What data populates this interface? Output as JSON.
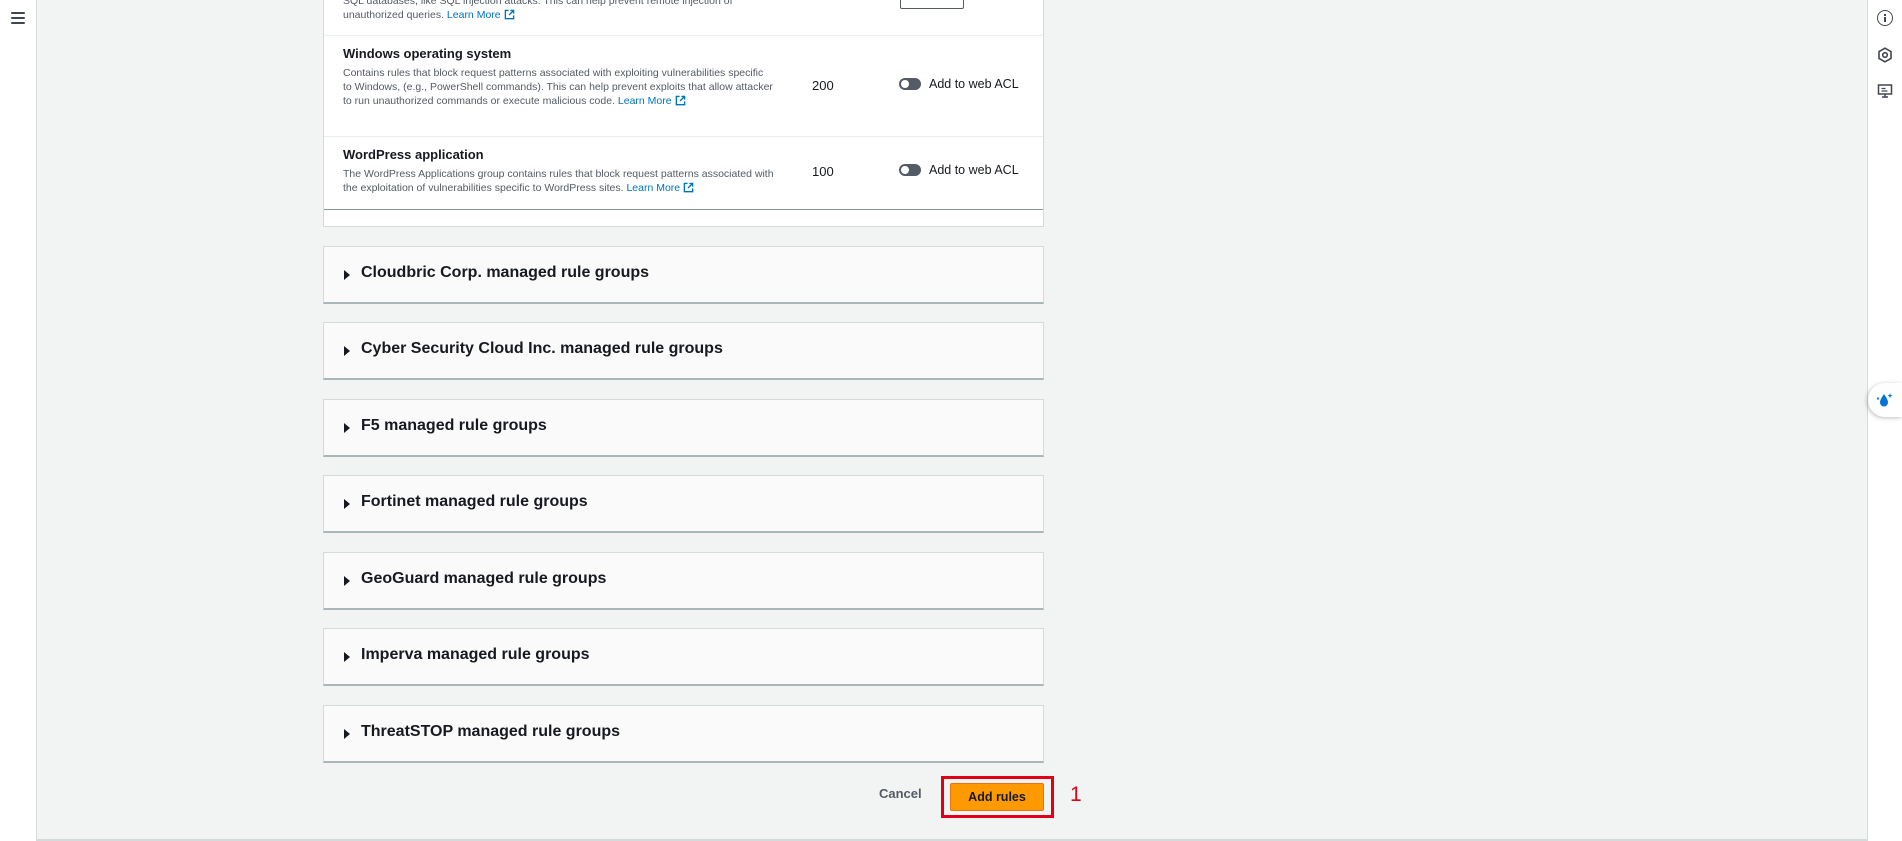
{
  "rules": [
    {
      "title": "",
      "description": "SQL databases, like SQL injection attacks. This can help prevent remote injection of unauthorized queries.",
      "learn_more": "Learn More",
      "capacity": "",
      "toggle_label": ""
    },
    {
      "title": "Windows operating system",
      "description": "Contains rules that block request patterns associated with exploiting vulnerabilities specific to Windows, (e.g., PowerShell commands). This can help prevent exploits that allow attacker to run unauthorized commands or execute malicious code.",
      "learn_more": "Learn More",
      "capacity": "200",
      "toggle_label": "Add to web ACL"
    },
    {
      "title": "WordPress application",
      "description": "The WordPress Applications group contains rules that block request patterns associated with the exploitation of vulnerabilities specific to WordPress sites.",
      "learn_more": "Learn More",
      "capacity": "100",
      "toggle_label": "Add to web ACL"
    }
  ],
  "groups": [
    "Cloudbric Corp. managed rule groups",
    "Cyber Security Cloud Inc. managed rule groups",
    "F5 managed rule groups",
    "Fortinet managed rule groups",
    "GeoGuard managed rule groups",
    "Imperva managed rule groups",
    "ThreatSTOP managed rule groups"
  ],
  "footer": {
    "cancel_label": "Cancel",
    "add_label": "Add rules",
    "annotation": "1"
  },
  "icons": {
    "nav": "hamburger-menu-icon",
    "rail": [
      "info-icon",
      "hexagon-settings-icon",
      "monitor-icon"
    ],
    "assistant": "ai-sparkle-icon",
    "link": "external-link-icon"
  },
  "colors": {
    "primary_button": "#ff9900",
    "link": "#0073bb",
    "highlight": "#e00017",
    "background": "#f2f3f3"
  }
}
